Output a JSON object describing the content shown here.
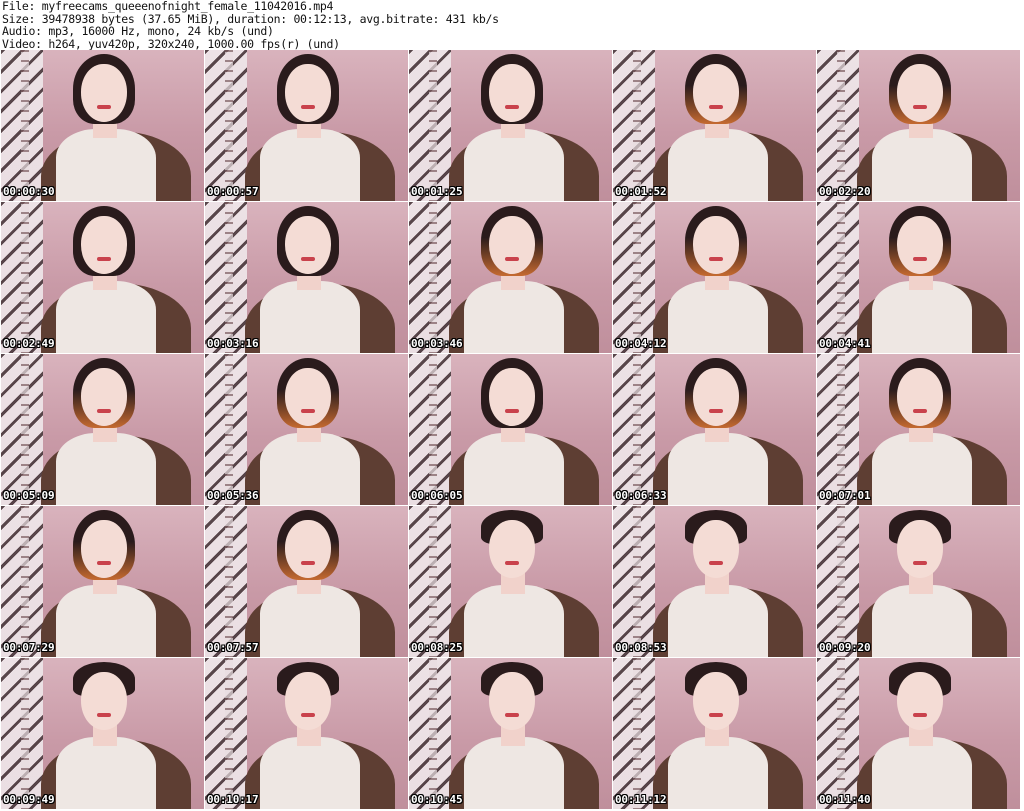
{
  "header": {
    "file_line": "File: myfreecams_queeenofnight_female_11042016.mp4",
    "size_line": "Size: 39478938 bytes (37.65 MiB), duration: 00:12:13, avg.bitrate: 431 kb/s",
    "audio_line": "Audio: mp3, 16000 Hz, mono, 24 kb/s (und)",
    "video_line": "Video: h264, yuv420p, 320x240, 1000.00 fps(r) (und)"
  },
  "thumbnails": [
    {
      "timestamp": "00:00:30",
      "hair": "dark"
    },
    {
      "timestamp": "00:00:57",
      "hair": "dark"
    },
    {
      "timestamp": "00:01:25",
      "hair": "dark"
    },
    {
      "timestamp": "00:01:52",
      "hair": "orange"
    },
    {
      "timestamp": "00:02:20",
      "hair": "orange"
    },
    {
      "timestamp": "00:02:49",
      "hair": "dark"
    },
    {
      "timestamp": "00:03:16",
      "hair": "dark"
    },
    {
      "timestamp": "00:03:46",
      "hair": "orange"
    },
    {
      "timestamp": "00:04:12",
      "hair": "orange"
    },
    {
      "timestamp": "00:04:41",
      "hair": "orange"
    },
    {
      "timestamp": "00:05:09",
      "hair": "orange"
    },
    {
      "timestamp": "00:05:36",
      "hair": "orange"
    },
    {
      "timestamp": "00:06:05",
      "hair": "dark"
    },
    {
      "timestamp": "00:06:33",
      "hair": "orange"
    },
    {
      "timestamp": "00:07:01",
      "hair": "orange"
    },
    {
      "timestamp": "00:07:29",
      "hair": "orange"
    },
    {
      "timestamp": "00:07:57",
      "hair": "orange"
    },
    {
      "timestamp": "00:08:25",
      "hair": "bun"
    },
    {
      "timestamp": "00:08:53",
      "hair": "bun"
    },
    {
      "timestamp": "00:09:20",
      "hair": "bun"
    },
    {
      "timestamp": "00:09:49",
      "hair": "bun"
    },
    {
      "timestamp": "00:10:17",
      "hair": "bun"
    },
    {
      "timestamp": "00:10:45",
      "hair": "bun"
    },
    {
      "timestamp": "00:11:12",
      "hair": "bun"
    },
    {
      "timestamp": "00:11:40",
      "hair": "bun"
    }
  ]
}
